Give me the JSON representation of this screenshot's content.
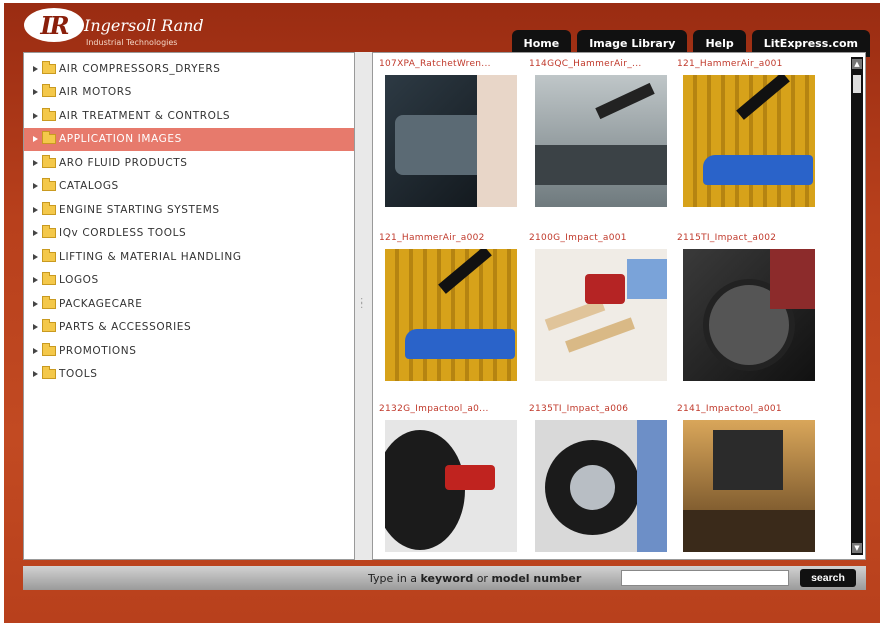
{
  "brand": {
    "mark": "IR",
    "name": "Ingersoll Rand",
    "tagline": "Industrial Technologies"
  },
  "nav": [
    "Home",
    "Image Library",
    "Help",
    "LitExpress.com"
  ],
  "tree": [
    {
      "label": "AIR COMPRESSORS_DRYERS",
      "selected": false
    },
    {
      "label": "AIR MOTORS",
      "selected": false
    },
    {
      "label": "AIR TREATMENT & CONTROLS",
      "selected": false
    },
    {
      "label": "APPLICATION IMAGES",
      "selected": true
    },
    {
      "label": "ARO FLUID PRODUCTS",
      "selected": false
    },
    {
      "label": "CATALOGS",
      "selected": false
    },
    {
      "label": "ENGINE STARTING SYSTEMS",
      "selected": false
    },
    {
      "label": "IQv CORDLESS TOOLS",
      "selected": false
    },
    {
      "label": "LIFTING & MATERIAL HANDLING",
      "selected": false
    },
    {
      "label": "LOGOS",
      "selected": false
    },
    {
      "label": "PACKAGECARE",
      "selected": false
    },
    {
      "label": "PARTS & ACCESSORIES",
      "selected": false
    },
    {
      "label": "PROMOTIONS",
      "selected": false
    },
    {
      "label": "TOOLS",
      "selected": false
    }
  ],
  "images": [
    {
      "title": "107XPA_RatchetWren...",
      "scene": "engine"
    },
    {
      "title": "114GQC_HammerAir_...",
      "scene": "car"
    },
    {
      "title": "121_HammerAir_a001",
      "scene": "yellow"
    },
    {
      "title": "121_HammerAir_a002",
      "scene": "yellow"
    },
    {
      "title": "2100G_Impact_a001",
      "scene": "wood"
    },
    {
      "title": "2115TI_Impact_a002",
      "scene": "shop"
    },
    {
      "title": "2132G_Impactool_a0...",
      "scene": "wheel"
    },
    {
      "title": "2135TI_Impact_a006",
      "scene": "wheel2"
    },
    {
      "title": "2141_Impactool_a001",
      "scene": "garage"
    }
  ],
  "search": {
    "prompt_prefix": "Type in a ",
    "prompt_keyword": "keyword",
    "prompt_mid": " or ",
    "prompt_model": "model number",
    "input_value": "",
    "button_label": "search"
  },
  "colors": {
    "frame": "#b8401c",
    "selected_row": "#e77a6c",
    "thumb_title": "#c0392b"
  }
}
